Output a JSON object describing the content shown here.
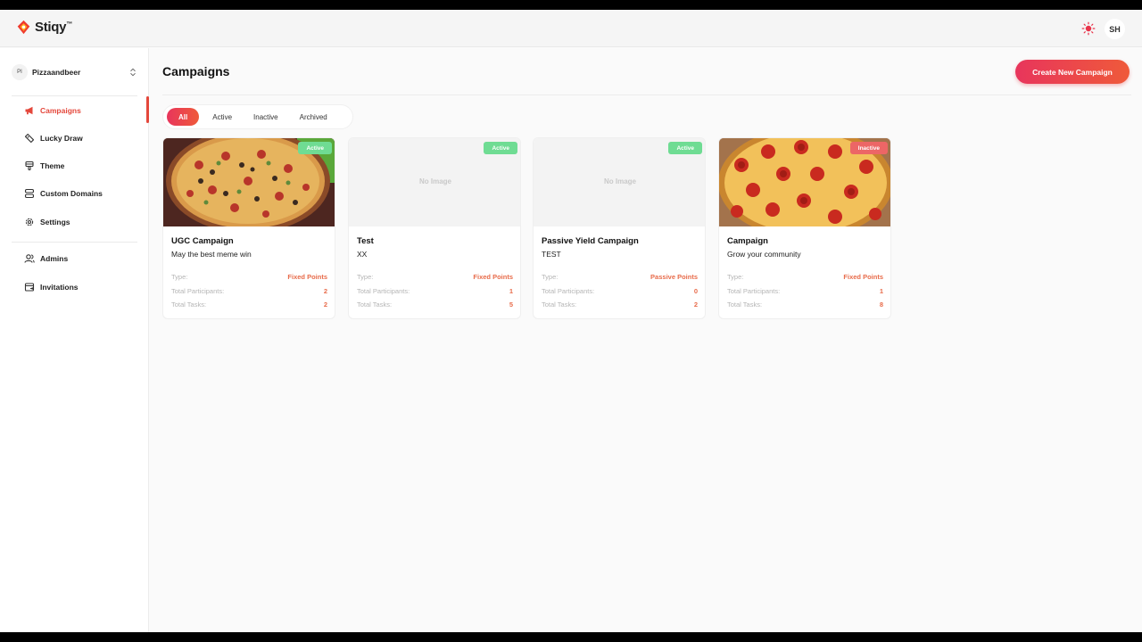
{
  "app": {
    "name": "Stiqy",
    "trademark": "™"
  },
  "header": {
    "user_initials": "SH"
  },
  "sidebar": {
    "org": {
      "initials": "PI",
      "name": "Pizzaandbeer",
      "chevron": "⌃⌄"
    },
    "items": [
      {
        "label": "Campaigns",
        "icon": "megaphone-icon"
      },
      {
        "label": "Lucky Draw",
        "icon": "ticket-icon"
      },
      {
        "label": "Theme",
        "icon": "palette-icon"
      },
      {
        "label": "Custom Domains",
        "icon": "domains-icon"
      },
      {
        "label": "Settings",
        "icon": "gear-icon"
      },
      {
        "label": "Admins",
        "icon": "users-icon"
      },
      {
        "label": "Invitations",
        "icon": "invitation-icon"
      }
    ]
  },
  "main": {
    "title": "Campaigns",
    "create_label": "Create New Campaign",
    "filters": [
      "All",
      "Active",
      "Inactive",
      "Archived"
    ],
    "labels": {
      "type": "Type:",
      "participants": "Total Participants:",
      "tasks": "Total Tasks:",
      "no_image": "No Image"
    },
    "cards": [
      {
        "title": "UGC Campaign",
        "desc": "May the best meme win",
        "status": "Active",
        "type": "Fixed Points",
        "participants": "2",
        "tasks": "2",
        "image": "pizza-mixed"
      },
      {
        "title": "Test",
        "desc": "XX",
        "status": "Active",
        "type": "Fixed Points",
        "participants": "1",
        "tasks": "5",
        "image": "none"
      },
      {
        "title": "Passive Yield Campaign",
        "desc": "TEST",
        "status": "Active",
        "type": "Passive Points",
        "participants": "0",
        "tasks": "2",
        "image": "none"
      },
      {
        "title": "Campaign",
        "desc": "Grow your community",
        "status": "Inactive",
        "type": "Fixed Points",
        "participants": "1",
        "tasks": "8",
        "image": "pizza-pepperoni"
      }
    ]
  },
  "colors": {
    "accent": "#e4473b",
    "active_badge": "#6fdc93",
    "inactive_badge": "#ec6666"
  }
}
